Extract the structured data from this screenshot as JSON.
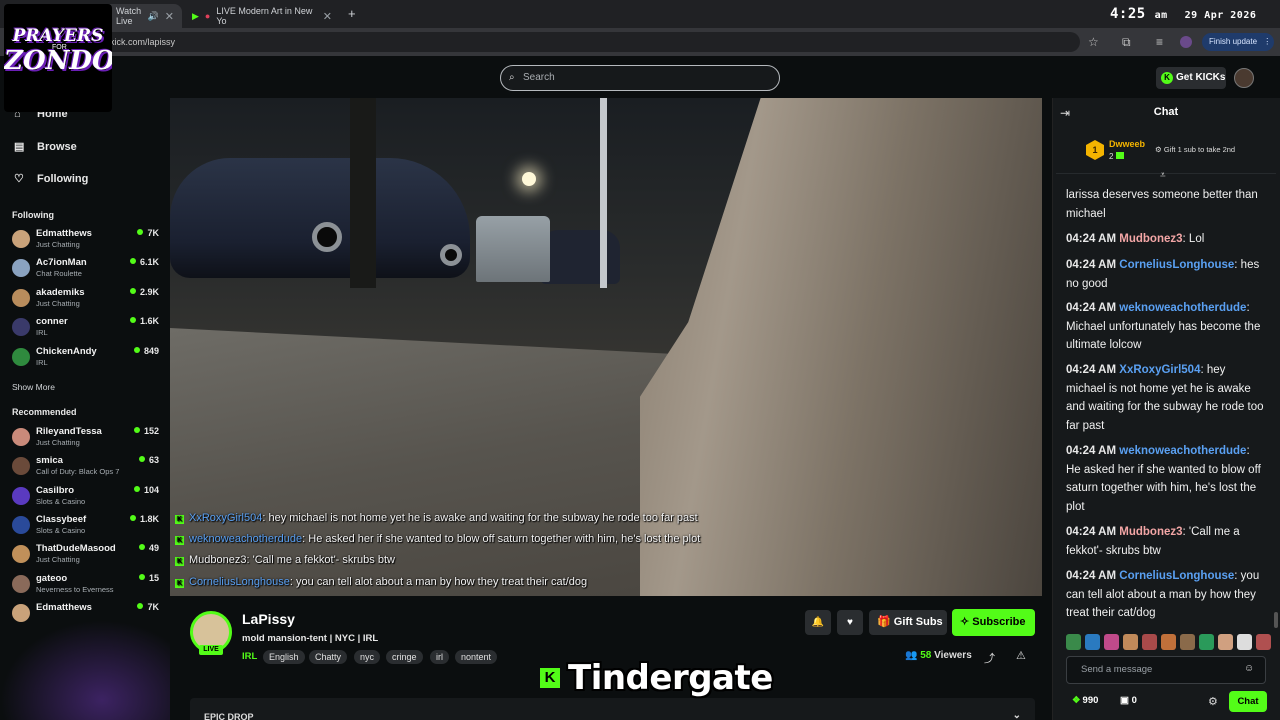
{
  "browser": {
    "tabs": [
      {
        "label": "Watch Live",
        "active": true
      },
      {
        "label": "LIVE Modern Art in New Yo",
        "active": false
      }
    ],
    "url": "kick.com/lapissy",
    "finish_update": "Finish update",
    "clock": {
      "time": "4:25",
      "ampm": "am",
      "date": "29 Apr 2026"
    }
  },
  "logo": {
    "line1": "PRAYERS",
    "for": "FOR",
    "line2": "ZONDO"
  },
  "header": {
    "search_placeholder": "Search",
    "get_kicks": "Get KICKs"
  },
  "sidebar": {
    "nav": [
      {
        "label": "Home",
        "icon": "home-icon"
      },
      {
        "label": "Browse",
        "icon": "browse-icon"
      },
      {
        "label": "Following",
        "icon": "heart-icon"
      }
    ],
    "following_title": "Following",
    "following": [
      {
        "name": "Edmatthews",
        "category": "Just Chatting",
        "viewers": "7K",
        "color": "#c9a27a"
      },
      {
        "name": "Ac7ionMan",
        "category": "Chat Roulette",
        "viewers": "6.1K",
        "color": "#8aa2c0"
      },
      {
        "name": "akademiks",
        "category": "Just Chatting",
        "viewers": "2.9K",
        "color": "#b88c5c"
      },
      {
        "name": "conner",
        "category": "IRL",
        "viewers": "1.6K",
        "color": "#3a3a6a"
      },
      {
        "name": "ChickenAndy",
        "category": "IRL",
        "viewers": "849",
        "color": "#2f8a3e"
      }
    ],
    "show_more": "Show More",
    "recommended_title": "Recommended",
    "recommended": [
      {
        "name": "RileyandTessa",
        "category": "Just Chatting",
        "viewers": "152",
        "color": "#c98a7a"
      },
      {
        "name": "smica",
        "category": "Call of Duty: Black Ops 7",
        "viewers": "63",
        "color": "#6a4a3a"
      },
      {
        "name": "Casilbro",
        "category": "Slots & Casino",
        "viewers": "104",
        "color": "#5a3ac0"
      },
      {
        "name": "Classybeef",
        "category": "Slots & Casino",
        "viewers": "1.8K",
        "color": "#2a4a9a"
      },
      {
        "name": "ThatDudeMasood",
        "category": "Just Chatting",
        "viewers": "49",
        "color": "#c0905a"
      },
      {
        "name": "gateoo",
        "category": "Neverness to Everness",
        "viewers": "15",
        "color": "#8a6a5a"
      },
      {
        "name": "Edmatthews",
        "category": "",
        "viewers": "7K",
        "color": "#c9a27a"
      }
    ]
  },
  "overlay_chat": [
    {
      "user": "XxRoxyGirl504",
      "user_color": "blue",
      "text": ": hey michael is not home yet he is awake and waiting for the subway he rode too far past"
    },
    {
      "user": "weknoweachotherdude",
      "user_color": "blue",
      "text": ": He asked her if she wanted to blow off saturn together with him, he's lost the plot"
    },
    {
      "user": "Mudbonez3",
      "user_color": "white",
      "text": ": 'Call me a fekkot'- skrubs btw"
    },
    {
      "user": "CorneliusLonghouse",
      "user_color": "blue",
      "text": ": you can tell alot about a man by how they treat their cat/dog"
    }
  ],
  "stream": {
    "streamer": "LaPissy",
    "live_tag": "LIVE",
    "title": "mold mansion-tent | NYC | IRL",
    "category": "IRL",
    "tags": [
      "English",
      "Chatty",
      "nyc",
      "cringe",
      "irl",
      "nontent"
    ],
    "gift_subs": "Gift Subs",
    "subscribe": "Subscribe",
    "viewers": "58",
    "viewers_label": "Viewers",
    "epic_drop": "EPIC DROP"
  },
  "caption": "Tindergate",
  "chat": {
    "title": "Chat",
    "pinned": {
      "user": "Dwweeb",
      "rank": "1",
      "gifts": "2",
      "cta": "Gift 1 sub to take 2nd"
    },
    "messages": [
      {
        "time": "",
        "user": "",
        "color": "#ffffff",
        "text": "larissa deserves someone better than michael"
      },
      {
        "time": "04:24 AM",
        "user": "Mudbonez3",
        "color": "#f3a6a6",
        "text": ": Lol"
      },
      {
        "time": "04:24 AM",
        "user": "CorneliusLonghouse",
        "color": "#5aa0f2",
        "text": ": hes no good"
      },
      {
        "time": "04:24 AM",
        "user": "weknoweachotherdude",
        "color": "#5aa0f2",
        "text": ": Michael unfortunately has become the ultimate lolcow"
      },
      {
        "time": "04:24 AM",
        "user": "XxRoxyGirl504",
        "color": "#5aa0f2",
        "text": ": hey michael is not home yet he is awake and waiting for the subway he rode too far past"
      },
      {
        "time": "04:24 AM",
        "user": "weknoweachotherdude",
        "color": "#5aa0f2",
        "text": ": He asked her if she wanted to blow off saturn together with him, he's lost the plot"
      },
      {
        "time": "04:24 AM",
        "user": "Mudbonez3",
        "color": "#f3a6a6",
        "text": ": 'Call me a fekkot'- skrubs btw"
      },
      {
        "time": "04:24 AM",
        "user": "CorneliusLonghouse",
        "color": "#5aa0f2",
        "text": ": you can tell alot about a man by how they treat their cat/dog"
      }
    ],
    "input_placeholder": "Send a message",
    "kicks": "990",
    "points": "0",
    "send": "Chat",
    "emote_colors": [
      "#3a8a4a",
      "#2a7ac0",
      "#c04a8a",
      "#c08a5a",
      "#a84a4a",
      "#c0703a",
      "#8a6a4a",
      "#2a9a5a",
      "#d0a080",
      "#ddd",
      "#b05050"
    ]
  }
}
